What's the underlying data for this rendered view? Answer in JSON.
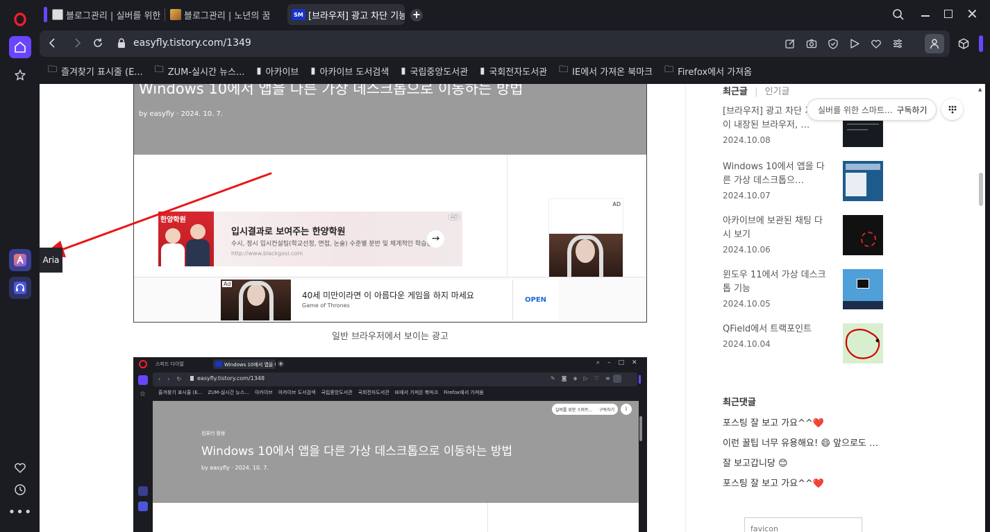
{
  "tabs": [
    {
      "title": "블로그관리 | 실버를 위한"
    },
    {
      "title": "블로그관리 | 노년의 꿈"
    },
    {
      "title": "[브라우저] 광고 차단 기능",
      "favicon_text": "SM"
    }
  ],
  "address": {
    "url": "easyfly.tistory.com/1349"
  },
  "bookmarks": [
    {
      "label": "즐겨찾기 표시줄 (E..."
    },
    {
      "label": "ZUM-실시간 뉴스..."
    },
    {
      "label": "아카이브"
    },
    {
      "label": "아카이브 도서검색"
    },
    {
      "label": "국립중앙도서관"
    },
    {
      "label": "국회전자도서관"
    },
    {
      "label": "IE에서 가져온 북마크"
    },
    {
      "label": "Firefox에서 가져옴"
    }
  ],
  "sidebar": {
    "tooltip": "Aria"
  },
  "post": {
    "title": "Windows 10에서 앱을 다른 가상 데스크톱으로 이동하는 방법",
    "meta": "by easyfly · 2024. 10. 7.",
    "ad1": {
      "badge": "AD",
      "logo": "한양학원",
      "title": "입시결과로 보여주는 한양학원",
      "desc": "수시, 정시 입시컨설팅(학교선정, 면접, 논술) 수준별 분반 및 체계적인 학습관리",
      "url": "http://www.blackgosi.com"
    },
    "ad_side_badge": "AD",
    "ad2": {
      "badge": "Ad",
      "title": "40세 미만이라면 이 아름다운 게임을 하지 마세요",
      "sub": "Game of Thrones",
      "cta": "OPEN"
    },
    "caption": "일반 브라우저에서 보이는 광고",
    "nested": {
      "tab1": "스피드 다이얼",
      "tab2": "Windows 10에서 앱을 다",
      "url": "easyfly.tistory.com/1348",
      "bookmarks": [
        "즐겨찾기 표시줄 (E...",
        "ZUM-실시간 뉴스...",
        "아카이브",
        "아카이브 도서검색",
        "국립중앙도서관",
        "국회전자도서관",
        "IE에서 가져온 북마크",
        "Firefox에서 가져옴"
      ],
      "subscribe_text": "실버를 위한 스마트...",
      "subscribe_btn": "구독하기",
      "category": "컴퓨터 활용",
      "title": "Windows 10에서 앱을 다른 가상 데스크톱으로 이동하는 방법",
      "meta": "by easyfly · 2024. 10. 7."
    }
  },
  "right": {
    "tab_recent": "최근글",
    "tab_sep": "|",
    "tab_popular": "인기글",
    "subscribe_text": "실버를 위한 스마트...",
    "subscribe_btn": "구독하기",
    "posts": [
      {
        "title": "[브라우저] 광고 차단 기능이 내장된 브라우저, …",
        "date": "2024.10.08"
      },
      {
        "title": "Windows 10에서 앱을 다른 가상 데스크톱으…",
        "date": "2024.10.07"
      },
      {
        "title": "아카이브에 보관된 채팅 다시 보기",
        "date": "2024.10.06"
      },
      {
        "title": "윈도우 11에서 가상 데스크톱 기능",
        "date": "2024.10.05"
      },
      {
        "title": "QField에서 트랙포인트",
        "date": "2024.10.04"
      }
    ],
    "comments_title": "최근댓글",
    "comments": [
      {
        "text": "포스팅 잘 보고 가요^^",
        "emoji": "❤️"
      },
      {
        "text": "이런 꿀팁 너무 유용해요! 😄 앞으로도 …",
        "emoji": ""
      },
      {
        "text": "잘 보고갑니당 ",
        "emoji": "😊"
      },
      {
        "text": "포스팅 잘 보고 가요^^",
        "emoji": "❤️"
      }
    ],
    "broken_image_alt": "favicon"
  }
}
